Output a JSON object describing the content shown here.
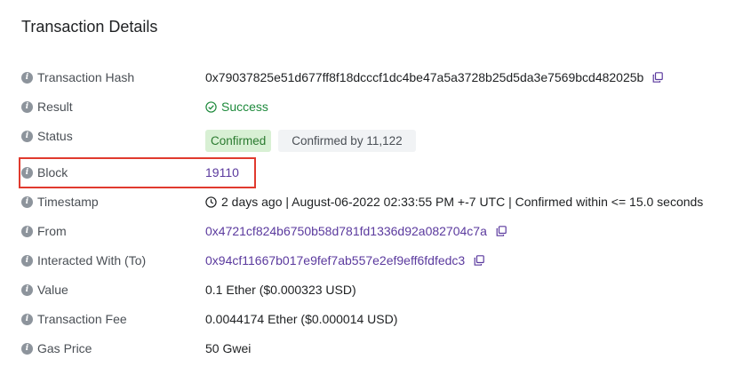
{
  "page": {
    "title": "Transaction Details"
  },
  "rows": {
    "hash": {
      "label": "Transaction Hash",
      "value": "0x79037825e51d677ff8f18dcccf1dc4be47a5a3728b25d5da3e7569bcd482025b"
    },
    "result": {
      "label": "Result",
      "value": "Success"
    },
    "status": {
      "label": "Status",
      "badge": "Confirmed",
      "confirmations": "Confirmed by 11,122"
    },
    "block": {
      "label": "Block",
      "value": "19110"
    },
    "timestamp": {
      "label": "Timestamp",
      "value": "2 days ago | August-06-2022 02:33:55 PM +-7 UTC | Confirmed within <= 15.0 seconds"
    },
    "from": {
      "label": "From",
      "value": "0x4721cf824b6750b58d781fd1336d92a082704c7a"
    },
    "to": {
      "label": "Interacted With (To)",
      "value": "0x94cf11667b017e9fef7ab557e2ef9eff6fdfedc3"
    },
    "value": {
      "label": "Value",
      "value": "0.1 Ether ($0.000323 USD)"
    },
    "fee": {
      "label": "Transaction Fee",
      "value": "0.0044174 Ether ($0.000014 USD)"
    },
    "gas": {
      "label": "Gas Price",
      "value": "50 Gwei"
    }
  },
  "icons": {
    "info": "info-icon",
    "copy": "copy-icon",
    "check": "check-circle-icon",
    "clock": "clock-icon"
  },
  "colors": {
    "link": "#5b3a9e",
    "success": "#1e8a3c",
    "highlight": "#e03a2e",
    "badge_bg": "#d8f0d4"
  }
}
